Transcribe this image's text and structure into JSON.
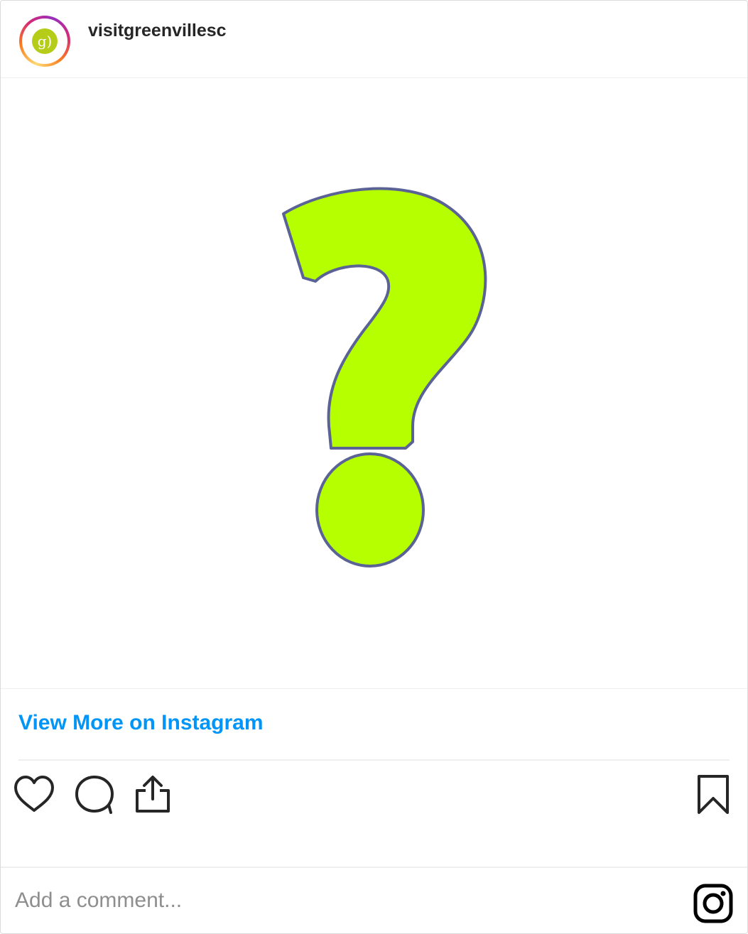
{
  "post": {
    "username": "visitgreenvillesc",
    "avatar_letter": "g)",
    "media_glyph": "question-mark",
    "view_more_label": "View More on Instagram"
  },
  "actions": {
    "like_icon": "heart-icon",
    "comment_icon": "comment-icon",
    "share_icon": "share-icon",
    "save_icon": "bookmark-icon"
  },
  "comment": {
    "placeholder": "Add a comment...",
    "brand_icon": "instagram-icon"
  },
  "colors": {
    "link": "#0095f6",
    "question_fill": "#b5ff00",
    "question_stroke": "#5a6296",
    "logo_green": "#b5cc18"
  }
}
